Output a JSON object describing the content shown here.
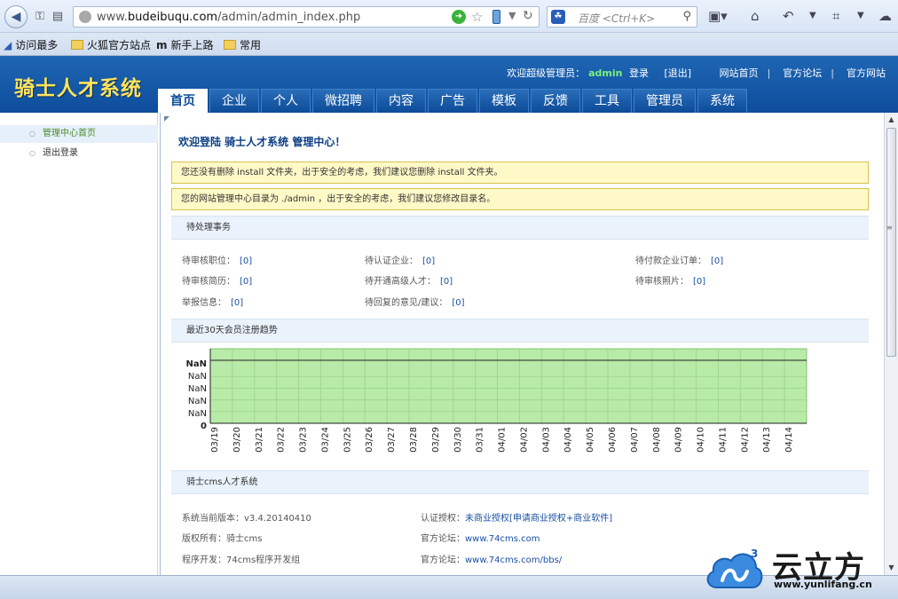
{
  "browser": {
    "url_prefix": "www.",
    "url_domain": "budeibuqu.com",
    "url_path": "/admin/admin_index.php",
    "search_placeholder": "百度 <Ctrl+K>",
    "bookmarks": [
      "访问最多",
      "火狐官方站点",
      "新手上路",
      "常用"
    ]
  },
  "header": {
    "logo": "骑士人才系统",
    "welcome_prefix": "欢迎超级管理员：",
    "username": "admin",
    "login": "登录",
    "logout": "[退出]",
    "links": [
      "网站首页",
      "官方论坛",
      "官方网站"
    ],
    "tabs": [
      "首页",
      "企业",
      "个人",
      "微招聘",
      "内容",
      "广告",
      "模板",
      "反馈",
      "工具",
      "管理员",
      "系统"
    ],
    "active_tab": "首页"
  },
  "sidebar": {
    "items": [
      "管理中心首页",
      "退出登录"
    ]
  },
  "main": {
    "welcome": "欢迎登陆 骑士人才系统 管理中心！",
    "alerts": [
      "您还没有删除 install 文件夹，出于安全的考虑，我们建议您删除 install 文件夹。",
      "您的网站管理中心目录为 ./admin ，出于安全的考虑，我们建议您修改目录名。"
    ],
    "pending_title": "待处理事务",
    "pending": [
      {
        "label": "待审核职位：",
        "value": "[0]"
      },
      {
        "label": "待认证企业：",
        "value": "[0]"
      },
      {
        "label": "待付款企业订单：",
        "value": "[0]"
      },
      {
        "label": "待审核简历：",
        "value": "[0]"
      },
      {
        "label": "待开通高级人才：",
        "value": "[0]"
      },
      {
        "label": "待审核照片：",
        "value": "[0]"
      },
      {
        "label": "举报信息：",
        "value": "[0]"
      },
      {
        "label": "待回复的意见/建议：",
        "value": "[0]"
      }
    ],
    "chart_title": "最近30天会员注册趋势",
    "sysinfo_title": "骑士cms人才系统",
    "sysinfo": {
      "version_label": "系统当前版本：",
      "version": "v3.4.20140410",
      "auth_label": "认证授权：",
      "auth_value": "未商业授权[申请商业授权+商业软件]",
      "copyright_label": "版权所有：",
      "copyright": "骑士cms",
      "forum_label": "官方论坛：",
      "forum": "www.74cms.com",
      "dev_label": "程序开发：",
      "dev": "74cms程序开发组",
      "forum2_label": "官方论坛：",
      "forum2": "www.74cms.com/bbs/"
    }
  },
  "chart_data": {
    "type": "area",
    "title": "",
    "x": [
      "03/19",
      "03/20",
      "03/21",
      "03/22",
      "03/23",
      "03/24",
      "03/25",
      "03/26",
      "03/27",
      "03/28",
      "03/29",
      "03/30",
      "03/31",
      "04/01",
      "04/02",
      "04/03",
      "04/04",
      "04/05",
      "04/06",
      "04/07",
      "04/08",
      "04/09",
      "04/10",
      "04/11",
      "04/12",
      "04/13",
      "04/14"
    ],
    "y_tick_labels": [
      "NaN",
      "NaN",
      "NaN",
      "NaN",
      "NaN",
      "0"
    ],
    "values": [
      0,
      0,
      0,
      0,
      0,
      0,
      0,
      0,
      0,
      0,
      0,
      0,
      0,
      0,
      0,
      0,
      0,
      0,
      0,
      0,
      0,
      0,
      0,
      0,
      0,
      0,
      0
    ],
    "fill_color": "#b8eaa8",
    "grid": true
  },
  "watermark": {
    "name": "云立方",
    "site": "www.yunlifang.cn",
    "superscript": "3"
  }
}
